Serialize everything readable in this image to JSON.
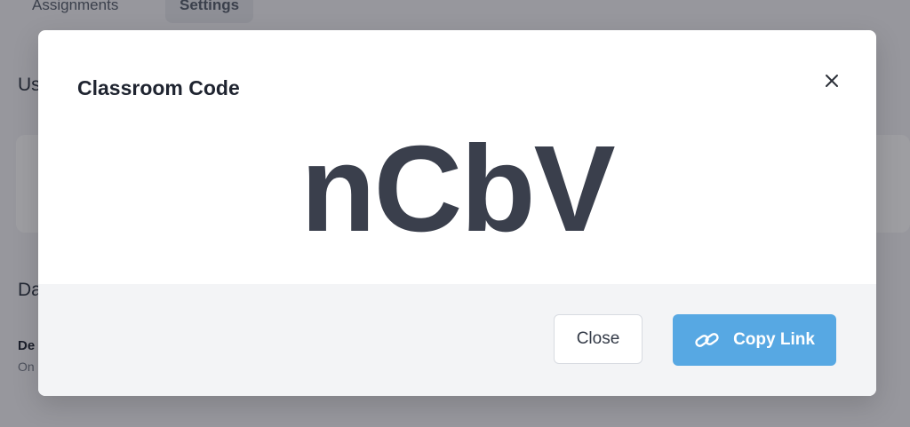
{
  "background": {
    "tabs": [
      "Assignments",
      "Settings"
    ],
    "heading_1": "Us",
    "heading_2": "Da",
    "label": "De",
    "sub": "On"
  },
  "modal": {
    "title": "Classroom Code",
    "code": "nCbV",
    "close_icon": "close-icon",
    "buttons": {
      "close_label": "Close",
      "copy_label": "Copy Link",
      "copy_icon": "link-icon"
    }
  },
  "colors": {
    "primary": "#57a8e3",
    "code_text": "#3a3f4c",
    "footer_bg": "#f3f4f6"
  }
}
